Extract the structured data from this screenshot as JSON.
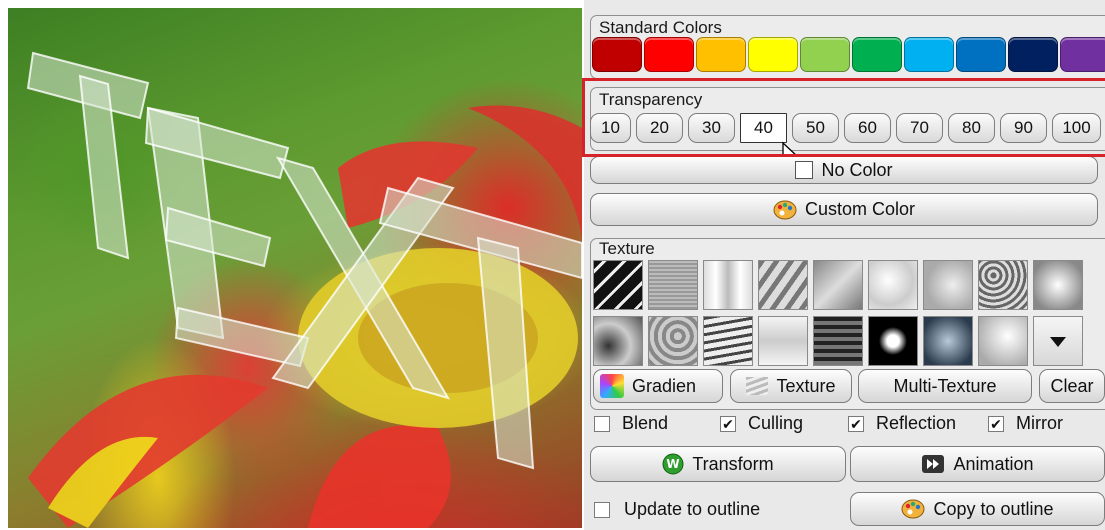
{
  "preview": {
    "text": "TEXT"
  },
  "standard_colors": {
    "title": "Standard Colors",
    "swatches": [
      "#c00000",
      "#ff0000",
      "#ffc000",
      "#ffff00",
      "#92d050",
      "#00b050",
      "#00b0f0",
      "#0070c0",
      "#002060",
      "#7030a0"
    ]
  },
  "transparency": {
    "title": "Transparency",
    "options": [
      "10",
      "20",
      "30",
      "40",
      "50",
      "60",
      "70",
      "80",
      "90",
      "100"
    ],
    "selected": "40"
  },
  "no_color": {
    "label": "No Color"
  },
  "custom_color": {
    "label": "Custom Color"
  },
  "texture": {
    "title": "Texture"
  },
  "texture_buttons": {
    "gradient": "Gradien",
    "texture": "Texture",
    "multi_texture": "Multi-Texture",
    "clear": "Clear"
  },
  "options": {
    "blend": {
      "label": "Blend",
      "checked": false
    },
    "culling": {
      "label": "Culling",
      "checked": true
    },
    "reflection": {
      "label": "Reflection",
      "checked": true
    },
    "mirror": {
      "label": "Mirror",
      "checked": true
    }
  },
  "actions": {
    "transform": "Transform",
    "animation": "Animation"
  },
  "outline": {
    "update_label": "Update to outline",
    "update_checked": false,
    "copy_label": "Copy to outline"
  },
  "colors": {
    "highlight": "#d6232a",
    "panel_bg": "#e9e9e9"
  }
}
